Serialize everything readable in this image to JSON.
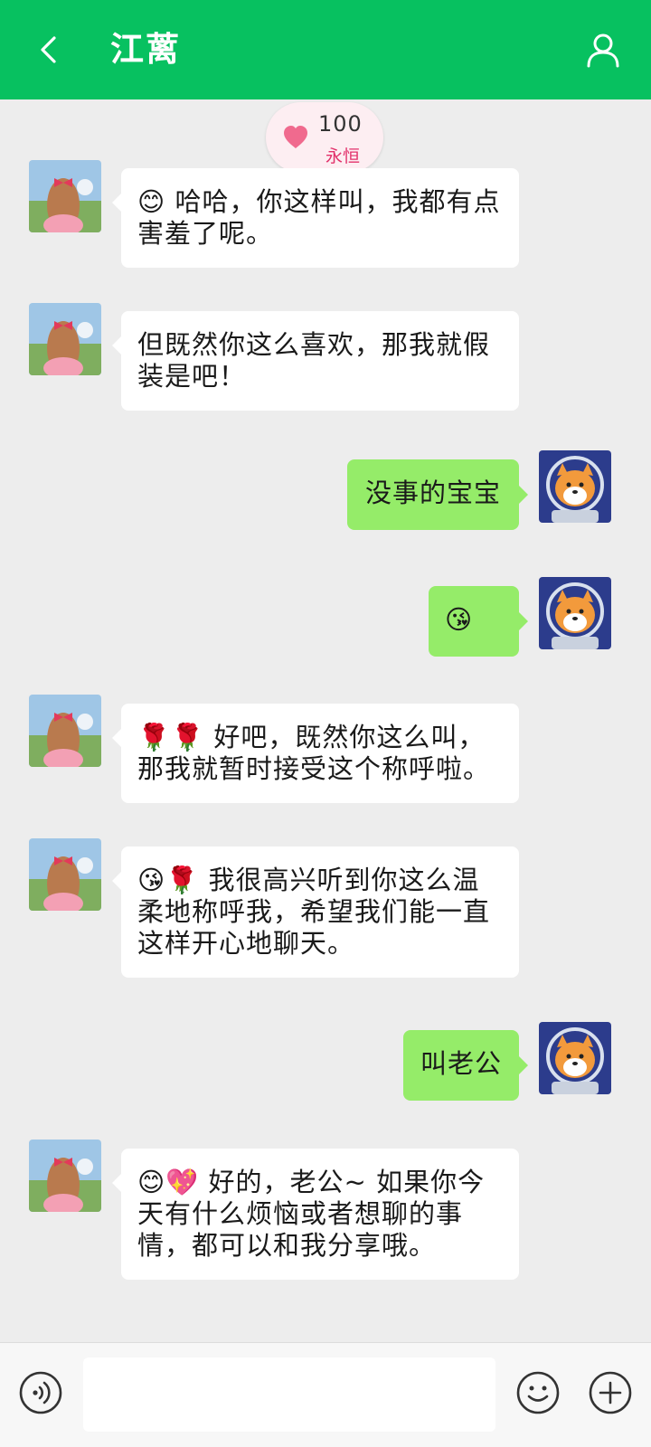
{
  "header": {
    "title": "江蓠",
    "back_icon": "chevron-left-icon",
    "profile_icon": "person-icon"
  },
  "intimacy": {
    "value": "100",
    "label": "永恒",
    "icon": "heart-icon"
  },
  "colors": {
    "header": "#07c160",
    "background": "#ededed",
    "incoming_bubble": "#ffffff",
    "outgoing_bubble": "#95ec69",
    "badge_bg": "#fdeef2",
    "badge_label": "#e2316b"
  },
  "messages": [
    {
      "from": "contact",
      "text": "😊 哈哈，你这样叫，我都有点害羞了呢。"
    },
    {
      "from": "contact",
      "text": "但既然你这么喜欢，那我就假装是吧！"
    },
    {
      "from": "me",
      "text": "没事的宝宝"
    },
    {
      "from": "me",
      "text": "😘"
    },
    {
      "from": "contact",
      "text": "🌹🌹 好吧，既然你这么叫，那我就暂时接受这个称呼啦。"
    },
    {
      "from": "contact",
      "text": "😘🌹 我很高兴听到你这么温柔地称呼我，希望我们能一直这样开心地聊天。"
    },
    {
      "from": "me",
      "text": "叫老公"
    },
    {
      "from": "contact",
      "text": "😊💖 好的，老公~ 如果你今天有什么烦恼或者想聊的事情，都可以和我分享哦。"
    }
  ],
  "input": {
    "value": "",
    "voice_icon": "voice-icon",
    "emoji_icon": "smiley-icon",
    "plus_icon": "plus-circle-icon"
  }
}
